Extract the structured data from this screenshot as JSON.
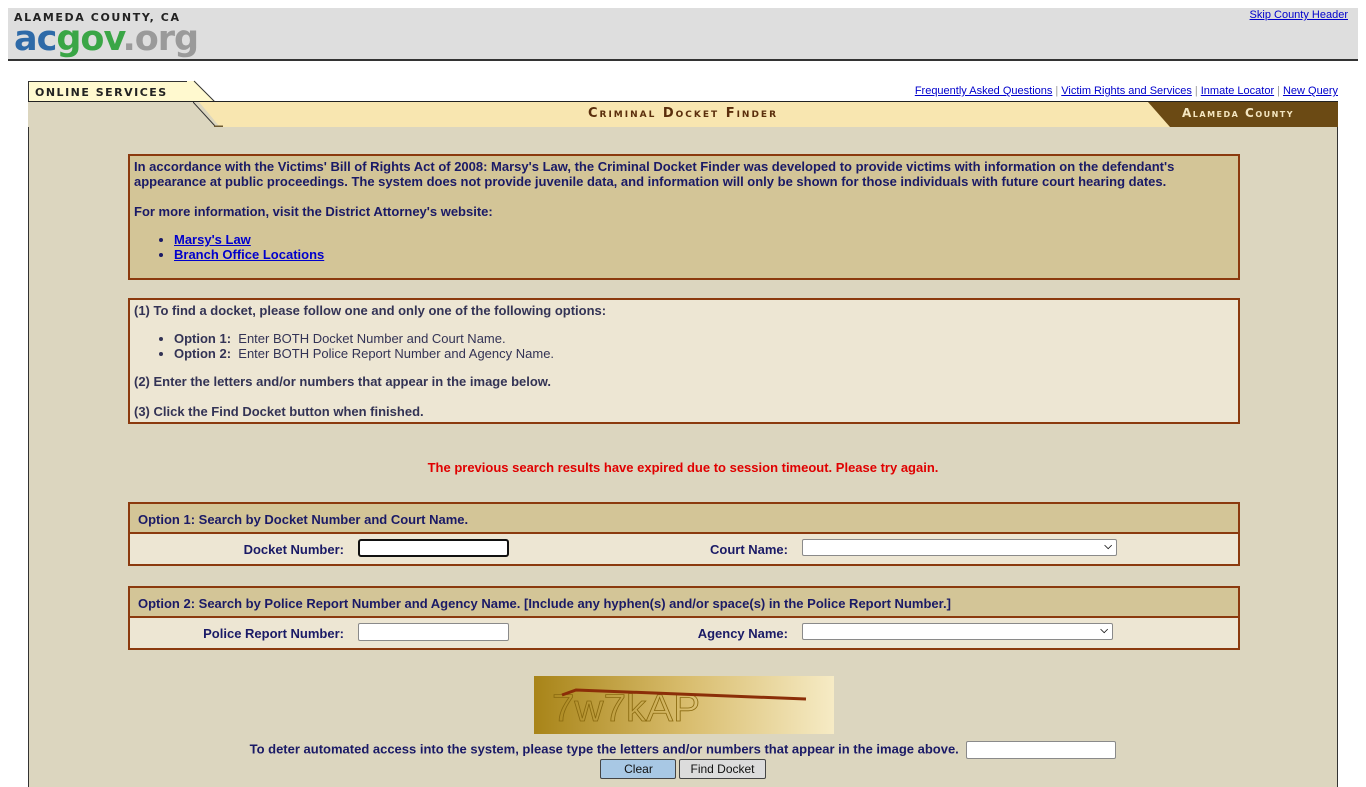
{
  "county_header": {
    "logo_top": "ALAMEDA COUNTY, CA",
    "logo_ac": "ac",
    "logo_gov": "gov",
    "logo_org": ".org",
    "skip_link": "Skip County Header"
  },
  "app_header": {
    "tab_label": "ONLINE SERVICES",
    "page_title": "Criminal Docket Finder",
    "county_label": "Alameda County",
    "links": [
      "Frequently Asked Questions",
      "Victim Rights and Services",
      "Inmate Locator",
      "New Query"
    ]
  },
  "info_box": {
    "paragraph": "In accordance with the Victims' Bill of Rights Act of 2008:  Marsy's Law, the Criminal Docket Finder was developed to provide victims with information on the defendant's appearance at public proceedings.  The system does not provide juvenile data, and information will only be shown for those individuals with future court hearing dates.",
    "more_info": "For more information, visit the District Attorney's website:",
    "links": [
      "Marsy's Law",
      "Branch Office Locations"
    ]
  },
  "steps_box": {
    "step1": "(1) To find a docket, please follow one and only one of the following options:",
    "options": [
      {
        "label": "Option 1:",
        "text": "Enter BOTH Docket Number and Court Name."
      },
      {
        "label": "Option 2:",
        "text": "Enter BOTH Police Report Number and Agency Name."
      }
    ],
    "step2": "(2) Enter the letters and/or numbers that appear in the image below.",
    "step3": "(3) Click the Find Docket button when finished."
  },
  "status_message": "The previous search results have expired due to session timeout.  Please try again.",
  "option1": {
    "heading": "Option 1:  Search by Docket Number and Court Name.",
    "docket_label": "Docket Number:",
    "docket_value": "",
    "court_label": "Court Name:",
    "court_selected": ""
  },
  "option2": {
    "heading": "Option 2:  Search by Police Report Number and Agency Name.  [Include any hyphen(s) and/or space(s) in the Police Report Number.]",
    "report_label": "Police Report Number:",
    "report_value": "",
    "agency_label": "Agency Name:",
    "agency_selected": ""
  },
  "captcha": {
    "image_text": "7w7kAP",
    "prompt": "To deter automated access into the system, please type the letters and/or numbers that appear in the image above.",
    "input_value": ""
  },
  "buttons": {
    "clear": "Clear",
    "find": "Find Docket"
  }
}
